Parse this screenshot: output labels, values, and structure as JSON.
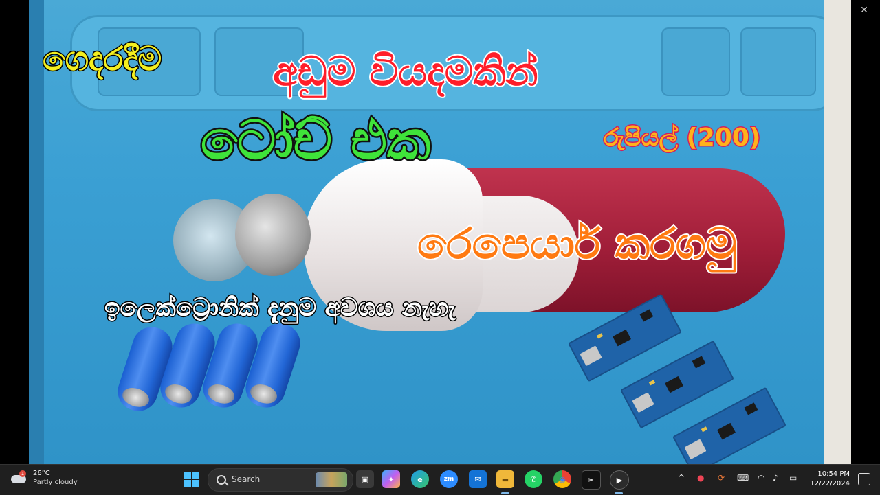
{
  "window": {
    "minimize_icon": "–",
    "restore_icon": "❐",
    "close_icon": "✕"
  },
  "thumbnail": {
    "line_1": "ගෙදරදීම",
    "line_2": "අඩුම වියදමකින්",
    "line_3": "ටෝච් එක",
    "price": "රුපියල් (200)",
    "line_4": "රෙපෙයාර් කරගමු",
    "line_5": "ඉලෙක්ට්‍රොනික් දැනුම අවශය නැහැ",
    "colors": {
      "line_1": "#f4ef1f",
      "line_2": "#ff1e2a",
      "line_3": "#3fe33a",
      "price": "#ffb21b",
      "line_4": "#ff7a12",
      "line_5": "#ffffff"
    }
  },
  "taskbar": {
    "weather": {
      "badge": "1",
      "temperature": "26°C",
      "condition": "Partly cloudy"
    },
    "search": {
      "label": "Search"
    },
    "apps": [
      {
        "name": "task-view",
        "glyph": "▣"
      },
      {
        "name": "copilot",
        "glyph": "✦"
      },
      {
        "name": "edge",
        "glyph": "e"
      },
      {
        "name": "zoom",
        "glyph": "zm"
      },
      {
        "name": "mail",
        "glyph": "✉"
      },
      {
        "name": "file-explorer",
        "glyph": "▬"
      },
      {
        "name": "whatsapp",
        "glyph": "✆"
      },
      {
        "name": "chrome",
        "glyph": "◉"
      },
      {
        "name": "capcut",
        "glyph": "✂"
      },
      {
        "name": "media-player",
        "glyph": "▶"
      }
    ],
    "tray": {
      "chevron": "^",
      "clock_time": "10:54 PM",
      "clock_date": "12/22/2024"
    }
  }
}
